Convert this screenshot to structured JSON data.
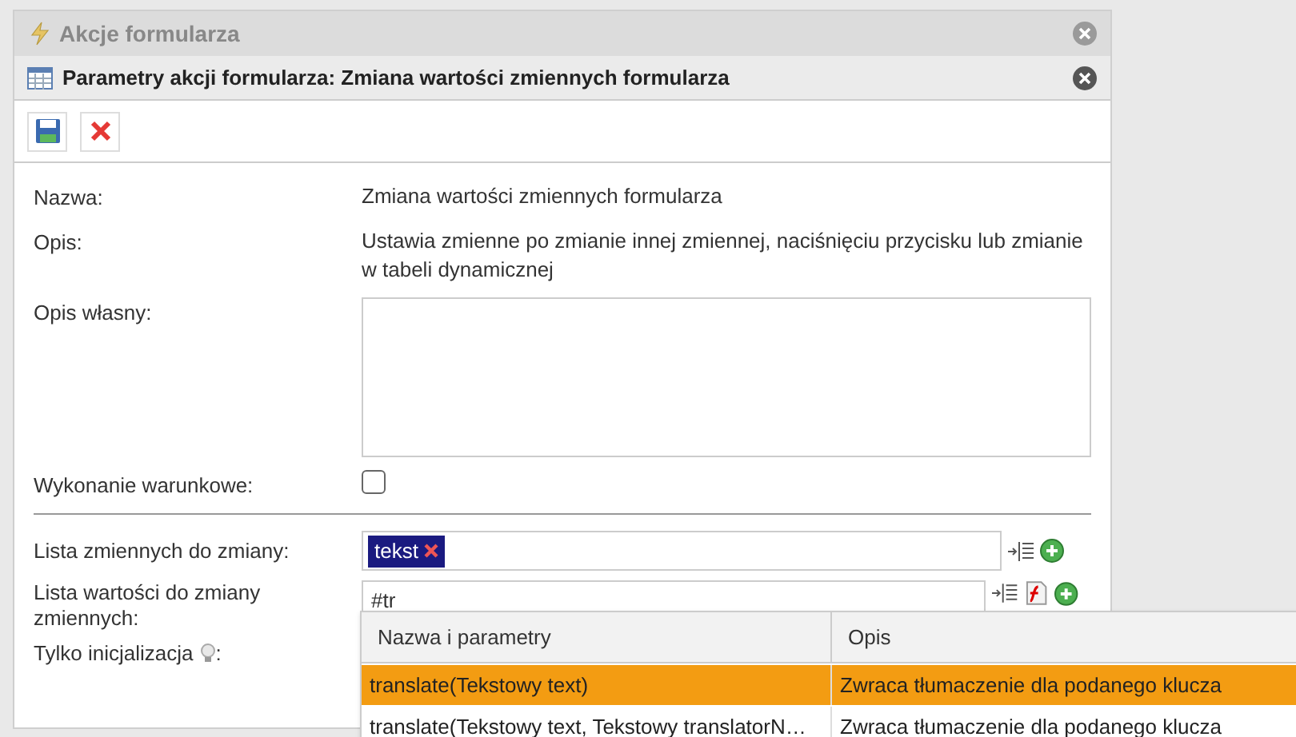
{
  "outer_window": {
    "title": "Akcje formularza"
  },
  "dialog": {
    "title": "Parametry akcji formularza: Zmiana wartości zmiennych formularza"
  },
  "fields": [
    {
      "kind": "text",
      "label": "Nazwa:",
      "value": "Zmiana wartości zmiennych formularza"
    },
    {
      "kind": "text",
      "label": "Opis:",
      "value": "Ustawia zmienne po zmianie innej zmiennej, naciśnięciu przycisku lub zmianie w tabeli dynamicznej"
    },
    {
      "kind": "textarea",
      "label": "Opis własny:"
    },
    {
      "kind": "checkbox",
      "label": "Wykonanie warunkowe:",
      "checked": false
    }
  ],
  "variables": {
    "label": "Lista zmiennych do zmiany:",
    "tags": [
      "tekst"
    ]
  },
  "values": {
    "label": "Lista wartości do zmiany zmiennych:",
    "value": "#tr"
  },
  "init_only": {
    "label": "Tylko inicjalizacja",
    "suffix": ":"
  },
  "autocomplete": {
    "columns": [
      "Nazwa i parametry",
      "Opis"
    ],
    "rows": [
      {
        "name": "translate(Tekstowy text)",
        "description": "Zwraca tłumaczenie dla podanego klucza",
        "selected": true
      },
      {
        "name": "translate(Tekstowy text, Tekstowy translatorN…",
        "description": "Zwraca tłumaczenie dla podanego klucza",
        "selected": false
      }
    ]
  }
}
